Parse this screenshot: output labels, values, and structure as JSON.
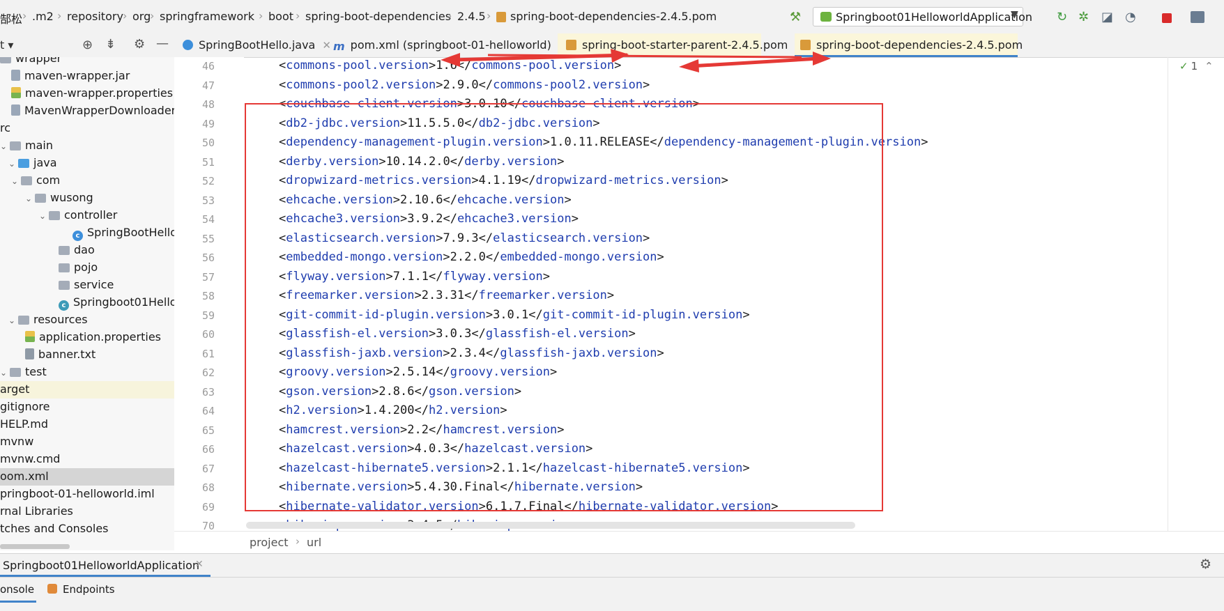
{
  "breadcrumbs": [
    "郜松",
    ".m2",
    "repository",
    "org",
    "springframework",
    "boot",
    "spring-boot-dependencies",
    "2.4.5",
    "spring-boot-dependencies-2.4.5.pom"
  ],
  "run_config": "Springboot01HelloworldApplication",
  "project_tree": [
    {
      "label": "wrapper",
      "icon": "folder-icon"
    },
    {
      "label": "maven-wrapper.jar",
      "icon": "jar-icon"
    },
    {
      "label": "maven-wrapper.properties",
      "icon": "properties-icon"
    },
    {
      "label": "MavenWrapperDownloader.ja",
      "icon": "java-file-icon"
    },
    {
      "label": "rc",
      "icon": ""
    },
    {
      "label": "main",
      "icon": "folder-icon"
    },
    {
      "label": "java",
      "icon": "source-folder-icon"
    },
    {
      "label": "com",
      "icon": "package-icon"
    },
    {
      "label": "wusong",
      "icon": "package-icon"
    },
    {
      "label": "controller",
      "icon": "package-icon"
    },
    {
      "label": "SpringBootHello",
      "icon": "class-icon"
    },
    {
      "label": "dao",
      "icon": "package-icon"
    },
    {
      "label": "pojo",
      "icon": "package-icon"
    },
    {
      "label": "service",
      "icon": "package-icon"
    },
    {
      "label": "Springboot01Hellov",
      "icon": "spring-class-icon"
    },
    {
      "label": "resources",
      "icon": "resources-folder-icon"
    },
    {
      "label": "application.properties",
      "icon": "properties-icon"
    },
    {
      "label": "banner.txt",
      "icon": "text-file-icon"
    },
    {
      "label": "test",
      "icon": "folder-icon"
    },
    {
      "label": "arget",
      "icon": ""
    },
    {
      "label": "gitignore",
      "icon": ""
    },
    {
      "label": "HELP.md",
      "icon": ""
    },
    {
      "label": "mvnw",
      "icon": ""
    },
    {
      "label": "mvnw.cmd",
      "icon": ""
    },
    {
      "label": "oom.xml",
      "icon": ""
    },
    {
      "label": "pringboot-01-helloworld.iml",
      "icon": ""
    },
    {
      "label": "rnal Libraries",
      "icon": ""
    },
    {
      "label": "tches and Consoles",
      "icon": ""
    }
  ],
  "tabs": [
    {
      "label": "SpringBootHello.java",
      "icon": "class-icon"
    },
    {
      "label": "pom.xml (springboot-01-helloworld)",
      "icon": "maven-icon"
    },
    {
      "label": "spring-boot-starter-parent-2.4.5.pom",
      "icon": "pom-icon"
    },
    {
      "label": "spring-boot-dependencies-2.4.5.pom",
      "icon": "pom-icon"
    }
  ],
  "inspection_count": "1",
  "code_lines": [
    {
      "n": "46",
      "tag": "commons-pool.version",
      "val": "1.6"
    },
    {
      "n": "47",
      "tag": "commons-pool2.version",
      "val": "2.9.0"
    },
    {
      "n": "48",
      "tag": "couchbase-client.version",
      "val": "3.0.10"
    },
    {
      "n": "49",
      "tag": "db2-jdbc.version",
      "val": "11.5.5.0"
    },
    {
      "n": "50",
      "tag": "dependency-management-plugin.version",
      "val": "1.0.11.RELEASE"
    },
    {
      "n": "51",
      "tag": "derby.version",
      "val": "10.14.2.0"
    },
    {
      "n": "52",
      "tag": "dropwizard-metrics.version",
      "val": "4.1.19"
    },
    {
      "n": "53",
      "tag": "ehcache.version",
      "val": "2.10.6"
    },
    {
      "n": "54",
      "tag": "ehcache3.version",
      "val": "3.9.2"
    },
    {
      "n": "55",
      "tag": "elasticsearch.version",
      "val": "7.9.3"
    },
    {
      "n": "56",
      "tag": "embedded-mongo.version",
      "val": "2.2.0"
    },
    {
      "n": "57",
      "tag": "flyway.version",
      "val": "7.1.1"
    },
    {
      "n": "58",
      "tag": "freemarker.version",
      "val": "2.3.31"
    },
    {
      "n": "59",
      "tag": "git-commit-id-plugin.version",
      "val": "3.0.1"
    },
    {
      "n": "60",
      "tag": "glassfish-el.version",
      "val": "3.0.3"
    },
    {
      "n": "61",
      "tag": "glassfish-jaxb.version",
      "val": "2.3.4"
    },
    {
      "n": "62",
      "tag": "groovy.version",
      "val": "2.5.14"
    },
    {
      "n": "63",
      "tag": "gson.version",
      "val": "2.8.6"
    },
    {
      "n": "64",
      "tag": "h2.version",
      "val": "1.4.200"
    },
    {
      "n": "65",
      "tag": "hamcrest.version",
      "val": "2.2"
    },
    {
      "n": "66",
      "tag": "hazelcast.version",
      "val": "4.0.3"
    },
    {
      "n": "67",
      "tag": "hazelcast-hibernate5.version",
      "val": "2.1.1"
    },
    {
      "n": "68",
      "tag": "hibernate.version",
      "val": "5.4.30.Final"
    },
    {
      "n": "69",
      "tag": "hibernate-validator.version",
      "val": "6.1.7.Final"
    },
    {
      "n": "70",
      "tag": "hikaricp.version",
      "val": "3.4.5"
    }
  ],
  "editor_breadcrumb": [
    "project",
    "url"
  ],
  "run_tab": "Springboot01HelloworldApplication",
  "bottom_tabs": [
    "onsole",
    "Endpoints"
  ],
  "colors": {
    "tag": "#1e3cae",
    "annotation": "#e53935",
    "active_tab_underline": "#4083c9"
  }
}
